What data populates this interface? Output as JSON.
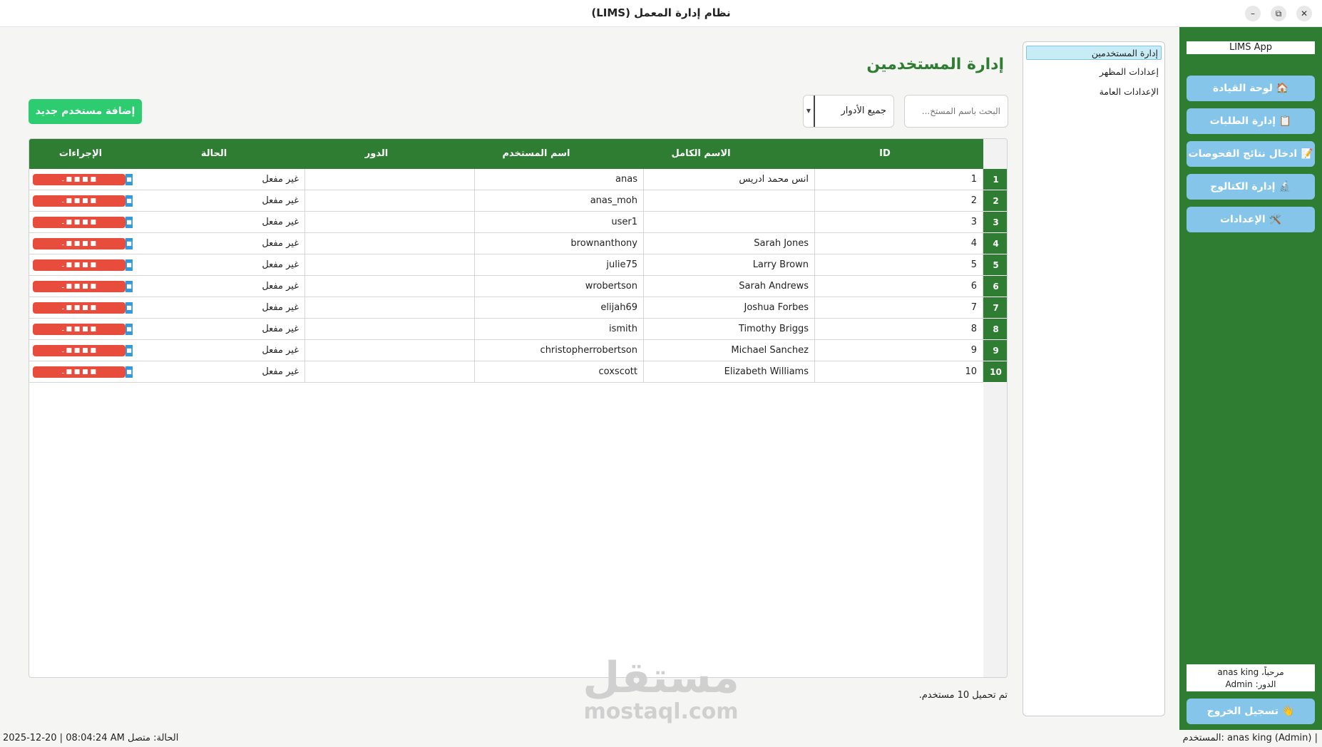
{
  "window": {
    "title": "نظام إدارة المعمل (LIMS)",
    "min_glyph": "–",
    "restore_glyph": "⧉",
    "close_glyph": "✕"
  },
  "sidebar": {
    "app_label": "LIMS App",
    "items": [
      {
        "label": "🏠 لوحة القيادة",
        "icon": "home-icon"
      },
      {
        "label": "📋 إدارة الطلبات",
        "icon": "clipboard-icon"
      },
      {
        "label": "📝 ادخال نتائج الفحوصات",
        "icon": "memo-icon"
      },
      {
        "label": "🔬 إدارة الكتالوج",
        "icon": "microscope-icon"
      },
      {
        "label": "🛠️ الإعدادات",
        "icon": "tools-icon"
      }
    ],
    "welcome": "مرحباً، anas king",
    "role": "الدور: Admin",
    "logout_label": "👋 تسجيل الخروج"
  },
  "settings_menu": {
    "items": [
      "إدارة المستخدمين",
      "إعدادات المظهر",
      "الإعدادات العامة"
    ],
    "active_index": 0
  },
  "main": {
    "page_title": "إدارة المستخدمين",
    "add_button": "إضافة مستخدم جديد",
    "search_placeholder": "البحث باسم المستخ...",
    "role_filter": "جميع الأدوار",
    "status_message": "تم تحميل 10 مستخدم."
  },
  "table": {
    "headers": {
      "id": "ID",
      "full_name": "الاسم الكامل",
      "username": "اسم المستخدم",
      "role": "الدور",
      "status": "الحالة",
      "actions": "الإجراءات"
    },
    "action_delete_text": "ـ ■ ■ ■ ■",
    "action_edit_text": "■",
    "rows": [
      {
        "num": "1",
        "id": "1",
        "full_name": "انس محمد ادريس",
        "username": "anas",
        "role": "",
        "status": "غير مفعل"
      },
      {
        "num": "2",
        "id": "2",
        "full_name": "",
        "username": "anas_moh",
        "role": "",
        "status": "غير مفعل"
      },
      {
        "num": "3",
        "id": "3",
        "full_name": "",
        "username": "user1",
        "role": "",
        "status": "غير مفعل"
      },
      {
        "num": "4",
        "id": "4",
        "full_name": "Sarah Jones",
        "username": "brownanthony",
        "role": "",
        "status": "غير مفعل"
      },
      {
        "num": "5",
        "id": "5",
        "full_name": "Larry Brown",
        "username": "julie75",
        "role": "",
        "status": "غير مفعل"
      },
      {
        "num": "6",
        "id": "6",
        "full_name": "Sarah Andrews",
        "username": "wrobertson",
        "role": "",
        "status": "غير مفعل"
      },
      {
        "num": "7",
        "id": "7",
        "full_name": "Joshua Forbes",
        "username": "elijah69",
        "role": "",
        "status": "غير مفعل"
      },
      {
        "num": "8",
        "id": "8",
        "full_name": "Timothy Briggs",
        "username": "ismith",
        "role": "",
        "status": "غير مفعل"
      },
      {
        "num": "9",
        "id": "9",
        "full_name": "Michael Sanchez",
        "username": "christopherrobertson",
        "role": "",
        "status": "غير مفعل"
      },
      {
        "num": "10",
        "id": "10",
        "full_name": "Elizabeth Williams",
        "username": "coxscott",
        "role": "",
        "status": "غير مفعل"
      }
    ]
  },
  "watermark": {
    "arabic": "مستقل",
    "latin": "mostaql.com"
  },
  "statusbar": {
    "left": "2025-12-20 | 08:04:24 AM   الحالة: متصل",
    "right": "المستخدم: anas king (Admin) |"
  },
  "colors": {
    "primary_green": "#2e7d32",
    "add_button": "#2ecc71",
    "nav_button": "#86c5ea",
    "delete_red": "#e74c3c",
    "edit_blue": "#3498db"
  }
}
